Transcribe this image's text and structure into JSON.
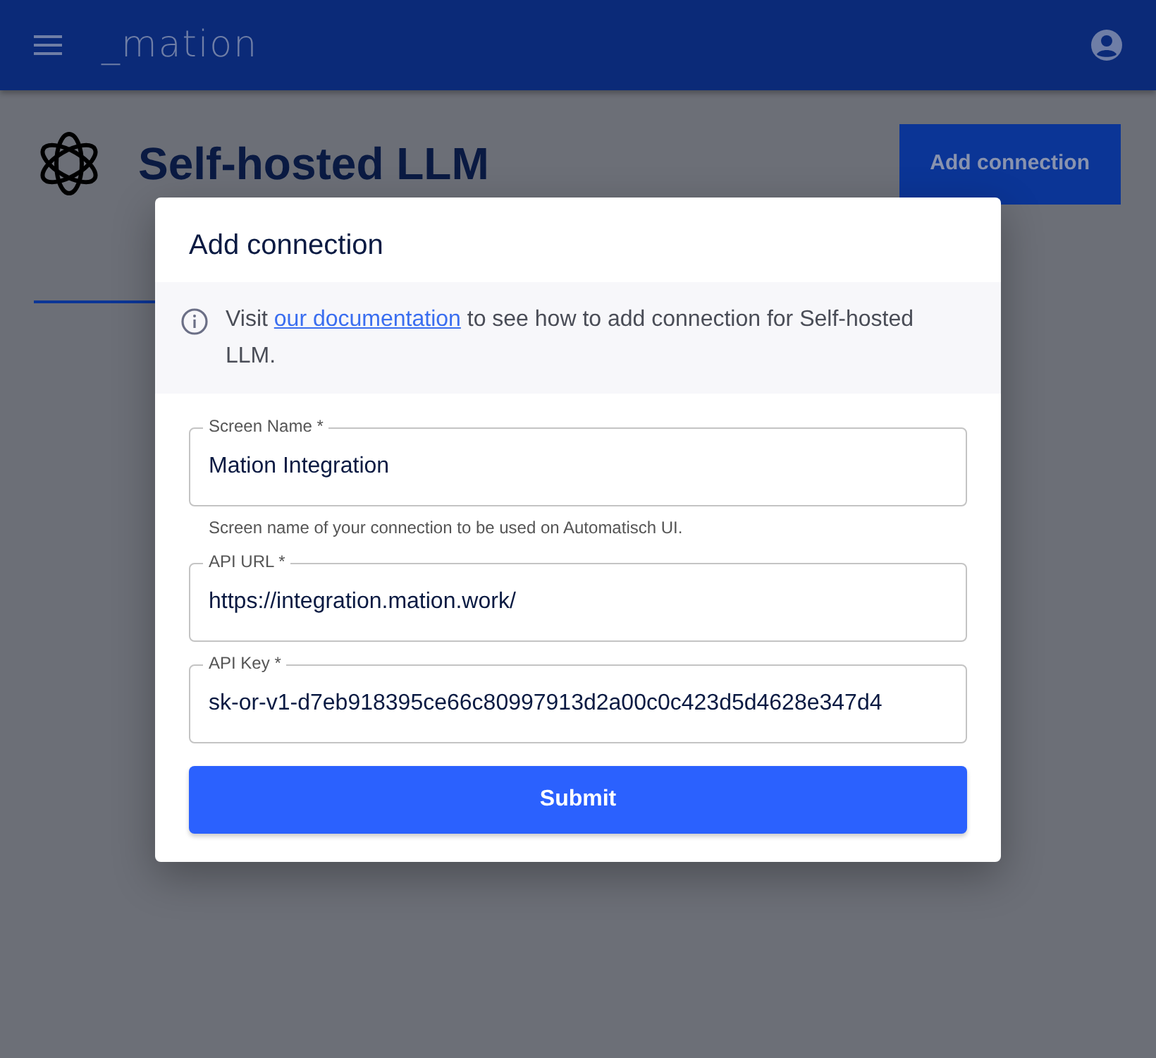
{
  "navbar": {
    "logo": "_mation"
  },
  "page": {
    "title": "Self-hosted LLM",
    "add_button": "Add connection"
  },
  "modal": {
    "title": "Add connection",
    "notice": {
      "before": "Visit ",
      "link": "our documentation",
      "after": " to see how to add connection for Self-hosted LLM."
    },
    "fields": [
      {
        "label": "Screen Name *",
        "value": "Mation Integration",
        "help": "Screen name of your connection to be used on Automatisch UI."
      },
      {
        "label": "API URL *",
        "value": "https://integration.mation.work/"
      },
      {
        "label": "API Key *",
        "value": "sk-or-v1-d7eb918395ce66c80997913d2a00c0c423d5d4628e347d4"
      }
    ],
    "submit": "Submit"
  }
}
